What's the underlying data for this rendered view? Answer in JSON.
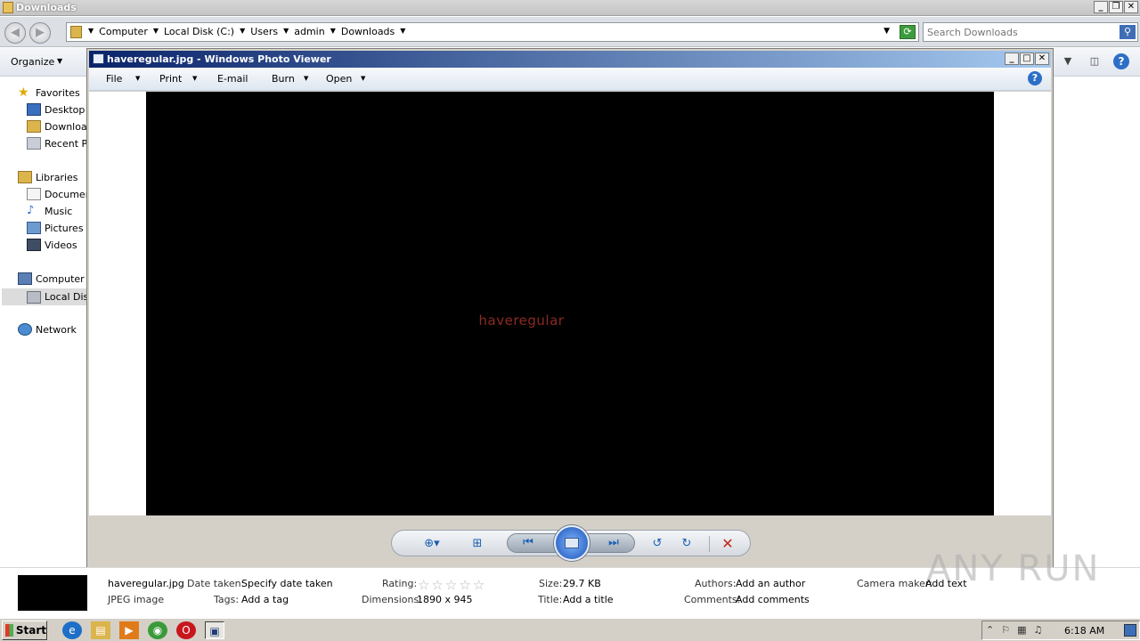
{
  "explorer": {
    "title": "Downloads",
    "breadcrumbs": [
      "Computer",
      "Local Disk (C:)",
      "Users",
      "admin",
      "Downloads"
    ],
    "search_placeholder": "Search Downloads",
    "organize_label": "Organize",
    "nav": {
      "favorites": "Favorites",
      "desktop": "Desktop",
      "downloads": "Downloac",
      "recent": "Recent Pl",
      "libraries": "Libraries",
      "documents": "Documen",
      "music": "Music",
      "pictures": "Pictures",
      "videos": "Videos",
      "computer": "Computer",
      "local_disk": "Local Disk",
      "network": "Network"
    }
  },
  "photo_viewer": {
    "title": "haveregular.jpg - Windows Photo Viewer",
    "menu": {
      "file": "File",
      "print": "Print",
      "email": "E-mail",
      "burn": "Burn",
      "open": "Open"
    },
    "help_label": "?",
    "image_text": "haveregular"
  },
  "details": {
    "filename": "haveregular.jpg",
    "filetype": "JPEG image",
    "date_taken_label": "Date taken:",
    "date_taken_value": "Specify date taken",
    "tags_label": "Tags:",
    "tags_value": "Add a tag",
    "rating_label": "Rating:",
    "rating_value": 0,
    "dimensions_label": "Dimensions:",
    "dimensions_value": "1890 x 945",
    "size_label": "Size:",
    "size_value": "29.7 KB",
    "title_label": "Title:",
    "title_value": "Add a title",
    "authors_label": "Authors:",
    "authors_value": "Add an author",
    "comments_label": "Comments:",
    "comments_value": "Add comments",
    "camera_label": "Camera maker:",
    "camera_value": "Add text"
  },
  "watermark": "ANY RUN",
  "taskbar": {
    "start_label": "Start",
    "clock": "6:18 AM"
  },
  "colors": {
    "photo_text": "#8b2a22",
    "title_gradient_start": "#0a246a",
    "delete_red": "#c0261c"
  }
}
